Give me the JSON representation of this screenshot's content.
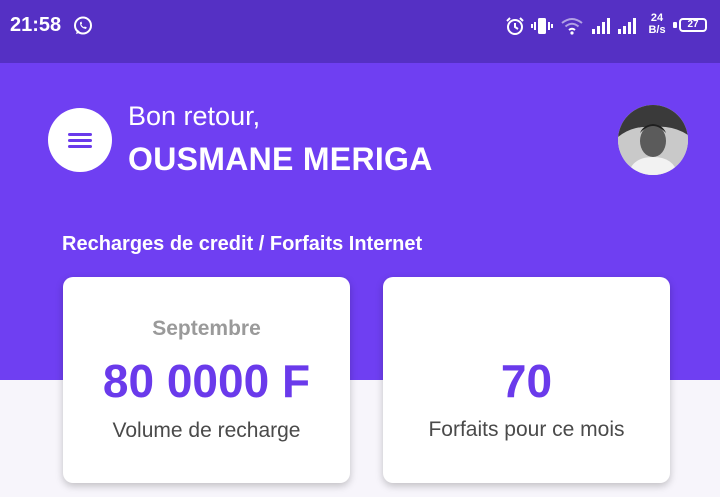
{
  "status_bar": {
    "time": "21:58",
    "net_speed_value": "24",
    "net_speed_unit": "B/s",
    "battery_level": "27",
    "icons": [
      "whatsapp-icon",
      "alarm-icon",
      "vibrate-icon",
      "wifi-icon",
      "signal-icon",
      "signal-icon",
      "battery-icon"
    ]
  },
  "header": {
    "greeting": "Bon retour,",
    "user_name": "OUSMANE MERIGA",
    "menu_icon": "menu-icon"
  },
  "section": {
    "title": "Recharges de credit / Forfaits Internet"
  },
  "cards": [
    {
      "month": "Septembre",
      "value": "80 0000 F",
      "label": "Volume de recharge"
    },
    {
      "month": "",
      "value": "70",
      "label": "Forfaits pour ce mois"
    }
  ],
  "colors": {
    "status_bar": "#5530c4",
    "header": "#6f3ff2",
    "accent_text": "#6a3aeb",
    "background": "#f7f5fb"
  }
}
